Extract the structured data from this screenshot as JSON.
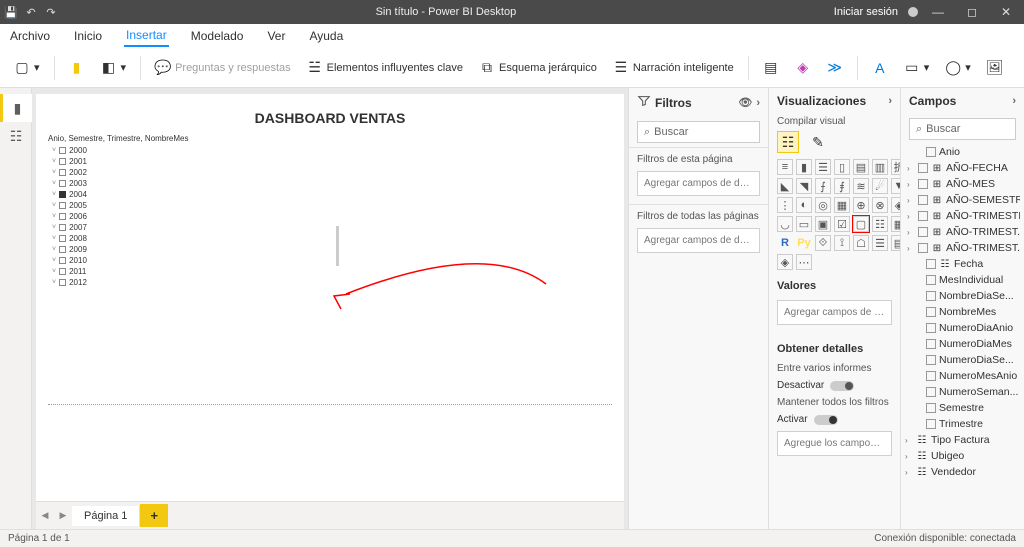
{
  "titlebar": {
    "title": "Sin título - Power BI Desktop",
    "signin": "Iniciar sesión"
  },
  "menu": {
    "file": "Archivo",
    "home": "Inicio",
    "insert": "Insertar",
    "model": "Modelado",
    "view": "Ver",
    "help": "Ayuda"
  },
  "ribbon": {
    "qa": "Preguntas y respuestas",
    "ki": "Elementos influyentes clave",
    "decomp": "Esquema jerárquico",
    "smart": "Narración inteligente"
  },
  "canvas": {
    "title": "DASHBOARD VENTAS",
    "visual_label": "Anio, Semestre, Trimestre, NombreMes",
    "years": [
      "2000",
      "2001",
      "2002",
      "2003",
      "2004",
      "2005",
      "2006",
      "2007",
      "2008",
      "2009",
      "2010",
      "2011",
      "2012"
    ],
    "selected_year": "2004"
  },
  "filters": {
    "header": "Filtros",
    "search": "Buscar",
    "page_label": "Filtros de esta página",
    "page_drop": "Agregar campos de datos ...",
    "all_label": "Filtros de todas las páginas",
    "all_drop": "Agregar campos de datos ..."
  },
  "viz": {
    "header": "Visualizaciones",
    "sub": "Compilar visual",
    "values": "Valores",
    "values_drop": "Agregar campos de datos a...",
    "drill_header": "Obtener detalles",
    "cross": "Entre varios informes",
    "off": "Desactivar",
    "keep": "Mantener todos los filtros",
    "on": "Activar",
    "drill_drop": "Agregue los campos de ob..."
  },
  "fields": {
    "header": "Campos",
    "search": "Buscar",
    "items": [
      {
        "label": "Anio",
        "indent": 1,
        "icon": ""
      },
      {
        "label": "AÑO-FECHA",
        "indent": 0,
        "icon": "hier",
        "chev": true
      },
      {
        "label": "AÑO-MES",
        "indent": 0,
        "icon": "hier",
        "chev": true
      },
      {
        "label": "AÑO-SEMESTRE",
        "indent": 0,
        "icon": "hier",
        "chev": true
      },
      {
        "label": "AÑO-TRIMESTRE",
        "indent": 0,
        "icon": "hier",
        "chev": true
      },
      {
        "label": "AÑO-TRIMEST...",
        "indent": 0,
        "icon": "hier",
        "chev": true
      },
      {
        "label": "AÑO-TRIMEST...",
        "indent": 0,
        "icon": "hier",
        "chev": true
      },
      {
        "label": "Fecha",
        "indent": 1,
        "icon": "cal"
      },
      {
        "label": "MesIndividual",
        "indent": 1,
        "icon": ""
      },
      {
        "label": "NombreDiaSe...",
        "indent": 1,
        "icon": ""
      },
      {
        "label": "NombreMes",
        "indent": 1,
        "icon": ""
      },
      {
        "label": "NumeroDiaAnio",
        "indent": 1,
        "icon": ""
      },
      {
        "label": "NumeroDiaMes",
        "indent": 1,
        "icon": ""
      },
      {
        "label": "NumeroDiaSe...",
        "indent": 1,
        "icon": ""
      },
      {
        "label": "NumeroMesAnio",
        "indent": 1,
        "icon": ""
      },
      {
        "label": "NumeroSeman...",
        "indent": 1,
        "icon": ""
      },
      {
        "label": "Semestre",
        "indent": 1,
        "icon": ""
      },
      {
        "label": "Trimestre",
        "indent": 1,
        "icon": ""
      },
      {
        "label": "Tipo Factura",
        "indent": -1,
        "icon": "table",
        "chev": true
      },
      {
        "label": "Ubigeo",
        "indent": -1,
        "icon": "table",
        "chev": true
      },
      {
        "label": "Vendedor",
        "indent": -1,
        "icon": "table",
        "chev": true
      }
    ]
  },
  "tabs": {
    "page1": "Página 1",
    "add": "+"
  },
  "status": {
    "left": "Página 1 de 1",
    "right": "Conexión disponible: conectada"
  }
}
